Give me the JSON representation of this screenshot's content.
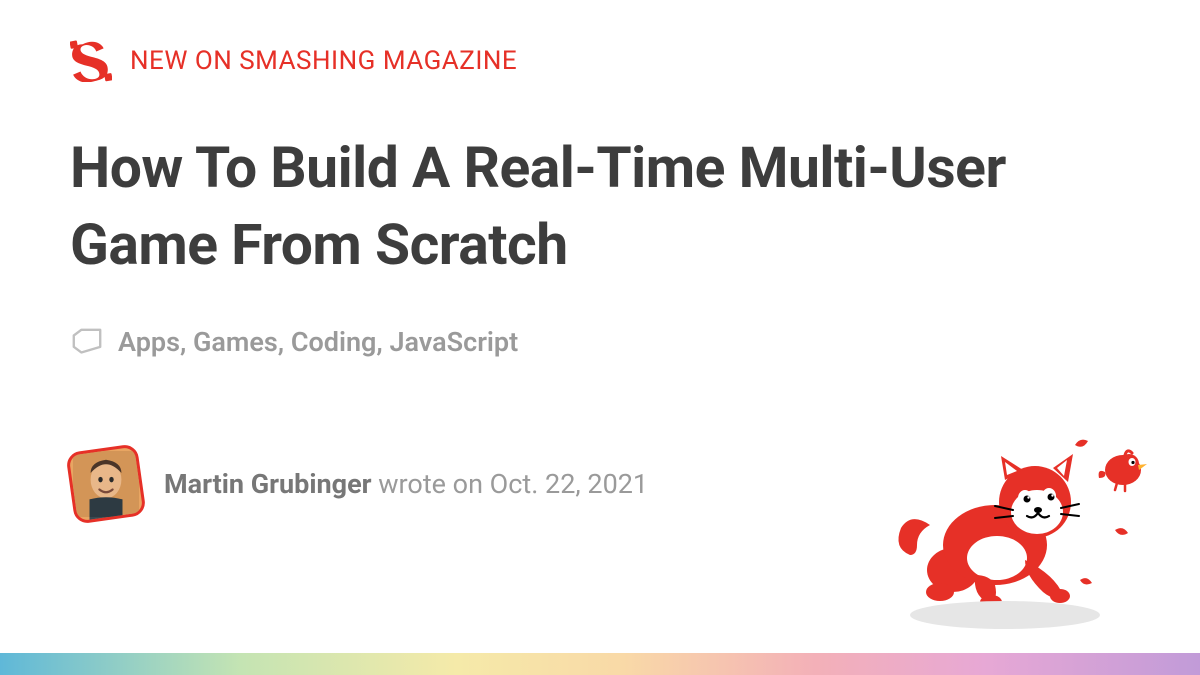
{
  "kicker": "NEW ON SMASHING MAGAZINE",
  "title": "How To Build A Real-Time Multi-User Game From Scratch",
  "tags": "Apps, Games, Coding, JavaScript",
  "author": {
    "name": "Martin Grubinger",
    "wrote_on_prefix": " wrote on ",
    "date": "Oct. 22, 2021"
  },
  "brand_color": "#E63027"
}
